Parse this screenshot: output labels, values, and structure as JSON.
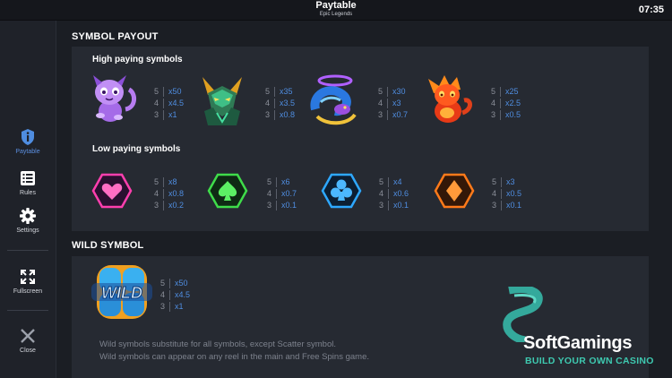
{
  "header": {
    "title": "Paytable",
    "subtitle": "Epic Legends",
    "clock": "07:35"
  },
  "sidebar": {
    "items": [
      {
        "label": "Paytable",
        "icon": "info-shield-icon",
        "active": true
      },
      {
        "label": "Rules",
        "icon": "list-icon"
      },
      {
        "label": "Settings",
        "icon": "gear-icon"
      },
      {
        "label": "Fullscreen",
        "icon": "fullscreen-icon"
      },
      {
        "label": "Close",
        "icon": "close-icon"
      }
    ]
  },
  "symbol_payout": {
    "title": "SYMBOL PAYOUT",
    "high": {
      "title": "High paying symbols",
      "symbols": [
        {
          "name": "purple-creature",
          "pays": [
            {
              "count": "5",
              "value": "x50"
            },
            {
              "count": "4",
              "value": "x4.5"
            },
            {
              "count": "3",
              "value": "x1"
            }
          ]
        },
        {
          "name": "green-fox-warrior",
          "pays": [
            {
              "count": "5",
              "value": "x35"
            },
            {
              "count": "4",
              "value": "x3.5"
            },
            {
              "count": "3",
              "value": "x0.8"
            }
          ]
        },
        {
          "name": "blue-serpent",
          "pays": [
            {
              "count": "5",
              "value": "x30"
            },
            {
              "count": "4",
              "value": "x3"
            },
            {
              "count": "3",
              "value": "x0.7"
            }
          ]
        },
        {
          "name": "red-fire-dragon",
          "pays": [
            {
              "count": "5",
              "value": "x25"
            },
            {
              "count": "4",
              "value": "x2.5"
            },
            {
              "count": "3",
              "value": "x0.5"
            }
          ]
        }
      ]
    },
    "low": {
      "title": "Low paying symbols",
      "symbols": [
        {
          "name": "heart-gem",
          "color": "#ff3fae",
          "pays": [
            {
              "count": "5",
              "value": "x8"
            },
            {
              "count": "4",
              "value": "x0.8"
            },
            {
              "count": "3",
              "value": "x0.2"
            }
          ]
        },
        {
          "name": "spade-gem",
          "color": "#3fdc4a",
          "pays": [
            {
              "count": "5",
              "value": "x6"
            },
            {
              "count": "4",
              "value": "x0.7"
            },
            {
              "count": "3",
              "value": "x0.1"
            }
          ]
        },
        {
          "name": "club-gem",
          "color": "#2ea8ff",
          "pays": [
            {
              "count": "5",
              "value": "x4"
            },
            {
              "count": "4",
              "value": "x0.6"
            },
            {
              "count": "3",
              "value": "x0.1"
            }
          ]
        },
        {
          "name": "diamond-gem",
          "color": "#ff7a1a",
          "pays": [
            {
              "count": "5",
              "value": "x3"
            },
            {
              "count": "4",
              "value": "x0.5"
            },
            {
              "count": "3",
              "value": "x0.1"
            }
          ]
        }
      ]
    }
  },
  "wild": {
    "title": "WILD SYMBOL",
    "symbol_text": "WILD",
    "pays": [
      {
        "count": "5",
        "value": "x50"
      },
      {
        "count": "4",
        "value": "x4.5"
      },
      {
        "count": "3",
        "value": "x1"
      }
    ],
    "description": [
      "Wild symbols substitute for all symbols, except Scatter symbol.",
      "Wild symbols can appear on any reel in the main and Free Spins game."
    ]
  },
  "watermark": {
    "name": "SoftGamings",
    "tagline": "BUILD YOUR OWN CASINO"
  },
  "colors": {
    "accent": "#4f8de0",
    "brand_teal": "#3ec9b0"
  }
}
